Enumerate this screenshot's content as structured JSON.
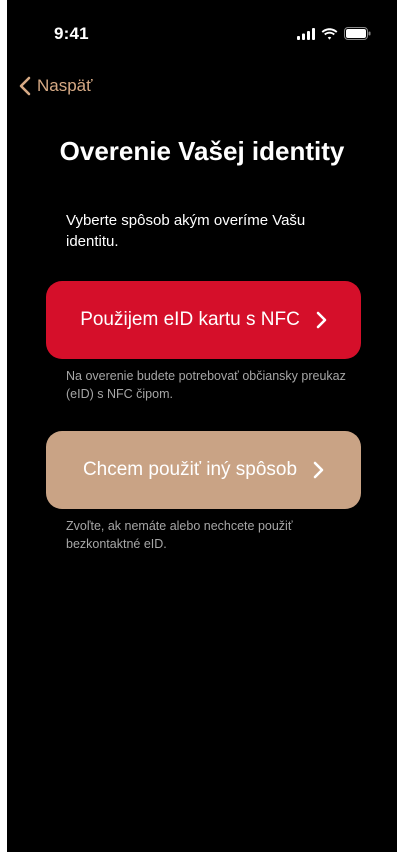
{
  "status_bar": {
    "time": "9:41",
    "icons": [
      "signal-icon",
      "wifi-icon",
      "battery-icon"
    ]
  },
  "nav": {
    "back_label": "Naspäť"
  },
  "page": {
    "title": "Overenie Vašej identity",
    "subtitle": "Vyberte spôsob akým overíme Vašu identitu."
  },
  "options": [
    {
      "label": "Použijem eID kartu s NFC",
      "note": "Na overenie budete potrebovať občiansky preukaz (eID) s NFC čipom.",
      "color": "#d50f2a"
    },
    {
      "label": "Chcem použiť iný spôsob",
      "note": "Zvoľte, ak nemáte alebo nechcete použiť bezkontaktné eID.",
      "color": "#c9a385"
    }
  ],
  "colors": {
    "background": "#000000",
    "accent": "#d6aa85",
    "secondary_text": "#a6a6a6"
  }
}
